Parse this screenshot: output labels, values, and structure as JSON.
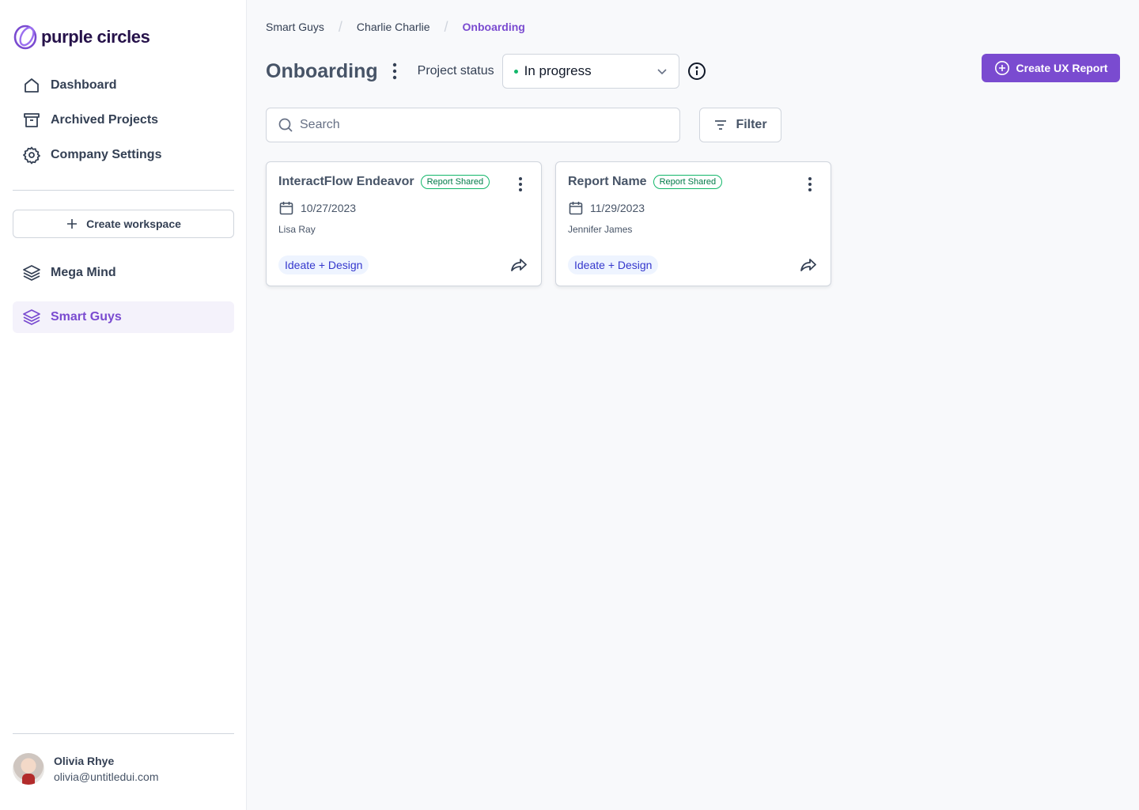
{
  "brand": {
    "name": "purple circles",
    "accent": "#7a4bd0"
  },
  "nav": [
    {
      "label": "Dashboard",
      "icon": "home-icon"
    },
    {
      "label": "Archived Projects",
      "icon": "archive-icon"
    },
    {
      "label": "Company Settings",
      "icon": "gear-icon"
    }
  ],
  "create_workspace_label": "Create workspace",
  "workspaces": [
    {
      "label": "Mega Mind",
      "icon": "layers-icon",
      "active": false
    },
    {
      "label": "Smart Guys",
      "icon": "layers-icon",
      "active": true
    }
  ],
  "user": {
    "name": "Olivia Rhye",
    "email": "olivia@untitledui.com"
  },
  "breadcrumb": [
    "Smart Guys",
    "Charlie Charlie",
    "Onboarding"
  ],
  "page": {
    "title": "Onboarding",
    "status_label": "Project status",
    "status_value": "In progress",
    "create_report_label": "Create UX Report"
  },
  "search": {
    "placeholder": "Search",
    "value": ""
  },
  "filter_label": "Filter",
  "cards": [
    {
      "title": "InteractFlow Endeavor",
      "badge": "Report Shared",
      "date": "10/27/2023",
      "owner": "Lisa Ray",
      "tag": "Ideate + Design"
    },
    {
      "title": "Report Name",
      "badge": "Report Shared",
      "date": "11/29/2023",
      "owner": "Jennifer James",
      "tag": "Ideate + Design"
    }
  ]
}
